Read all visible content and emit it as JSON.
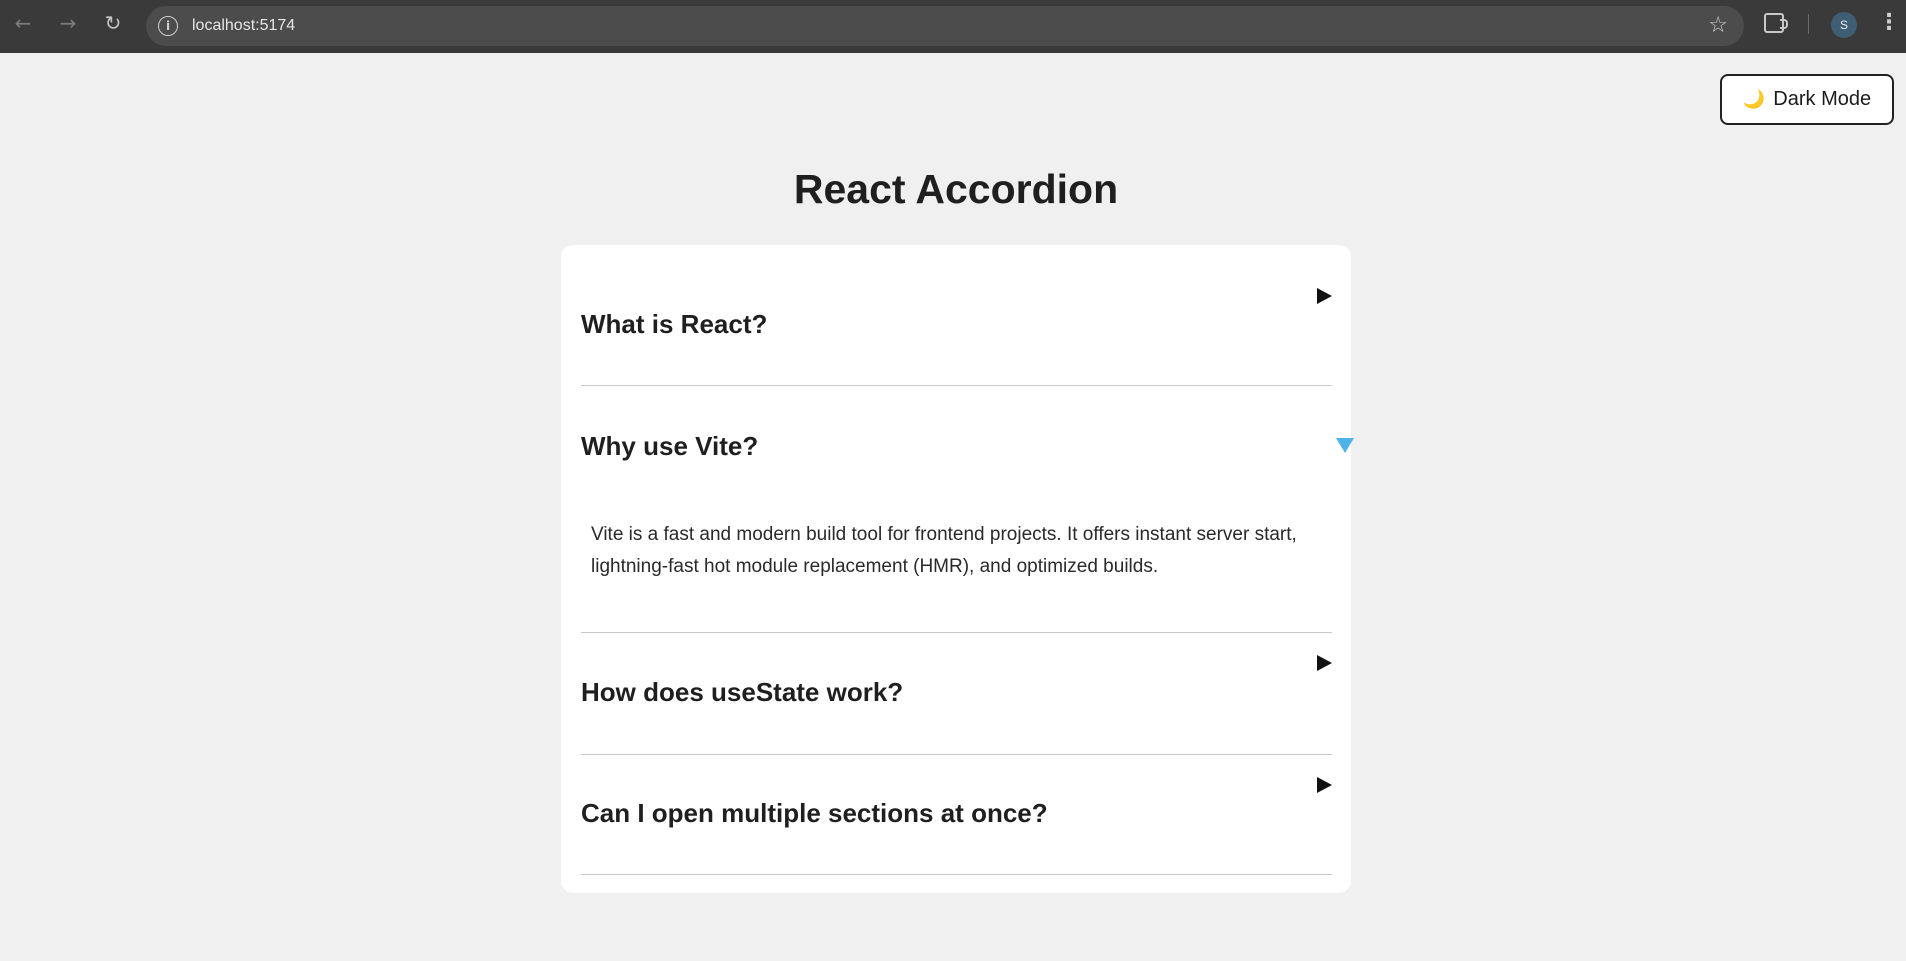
{
  "browser": {
    "url": "localhost:5174",
    "avatar_initial": "S",
    "icons": {
      "back": "arrow-left",
      "forward": "arrow-right",
      "reload": "refresh",
      "site_info": "info-circle",
      "bookmark": "star-outline",
      "extensions": "puzzle-piece",
      "menu": "vertical-dots"
    }
  },
  "theme_toggle": {
    "icon": "🌙",
    "label": "Dark Mode"
  },
  "page": {
    "title": "React Accordion"
  },
  "accordion": {
    "colors": {
      "open_arrow": "#4fb3ea",
      "closed_arrow": "#111111",
      "card_bg": "#ffffff",
      "page_bg": "#f0f0f0"
    },
    "items": [
      {
        "title": "What is React?",
        "open": false
      },
      {
        "title": "Why use Vite?",
        "open": true,
        "body": "Vite is a fast and modern build tool for frontend projects. It offers instant server start, lightning-fast hot module replacement (HMR), and optimized builds."
      },
      {
        "title": "How does useState work?",
        "open": false
      },
      {
        "title": "Can I open multiple sections at once?",
        "open": false
      }
    ]
  }
}
